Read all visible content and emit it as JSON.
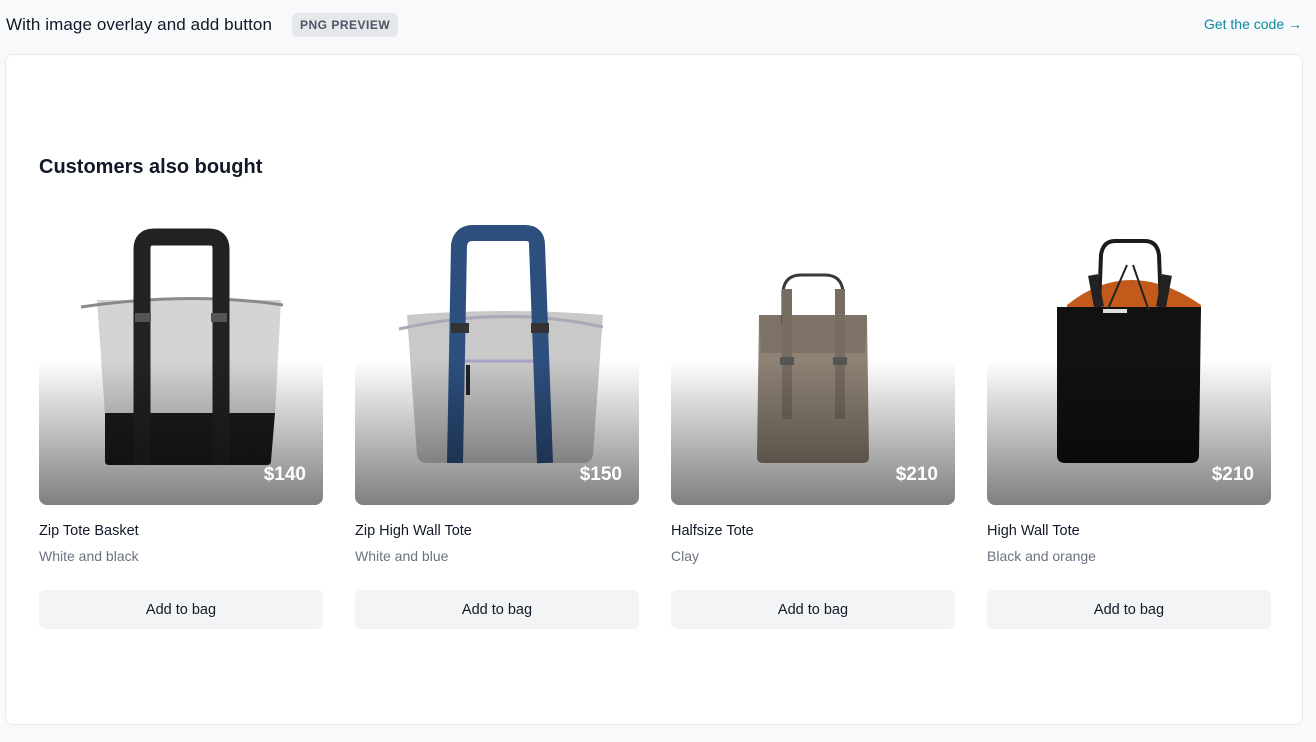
{
  "header": {
    "title": "With image overlay and add button",
    "badge": "PNG PREVIEW",
    "code_link": "Get the code →"
  },
  "section": {
    "title": "Customers also bought"
  },
  "products": [
    {
      "name": "Zip Tote Basket",
      "variant": "White and black",
      "price": "$140",
      "image": "zip-tote-basket-image",
      "button": "Add to bag"
    },
    {
      "name": "Zip High Wall Tote",
      "variant": "White and blue",
      "price": "$150",
      "image": "zip-high-wall-tote-image",
      "button": "Add to bag"
    },
    {
      "name": "Halfsize Tote",
      "variant": "Clay",
      "price": "$210",
      "image": "halfsize-tote-image",
      "button": "Add to bag"
    },
    {
      "name": "High Wall Tote",
      "variant": "Black and orange",
      "price": "$210",
      "image": "high-wall-tote-image",
      "button": "Add to bag"
    }
  ],
  "colors": {
    "link": "#0e8a9c",
    "button_bg": "#f3f4f6",
    "muted_text": "#6b7280"
  }
}
